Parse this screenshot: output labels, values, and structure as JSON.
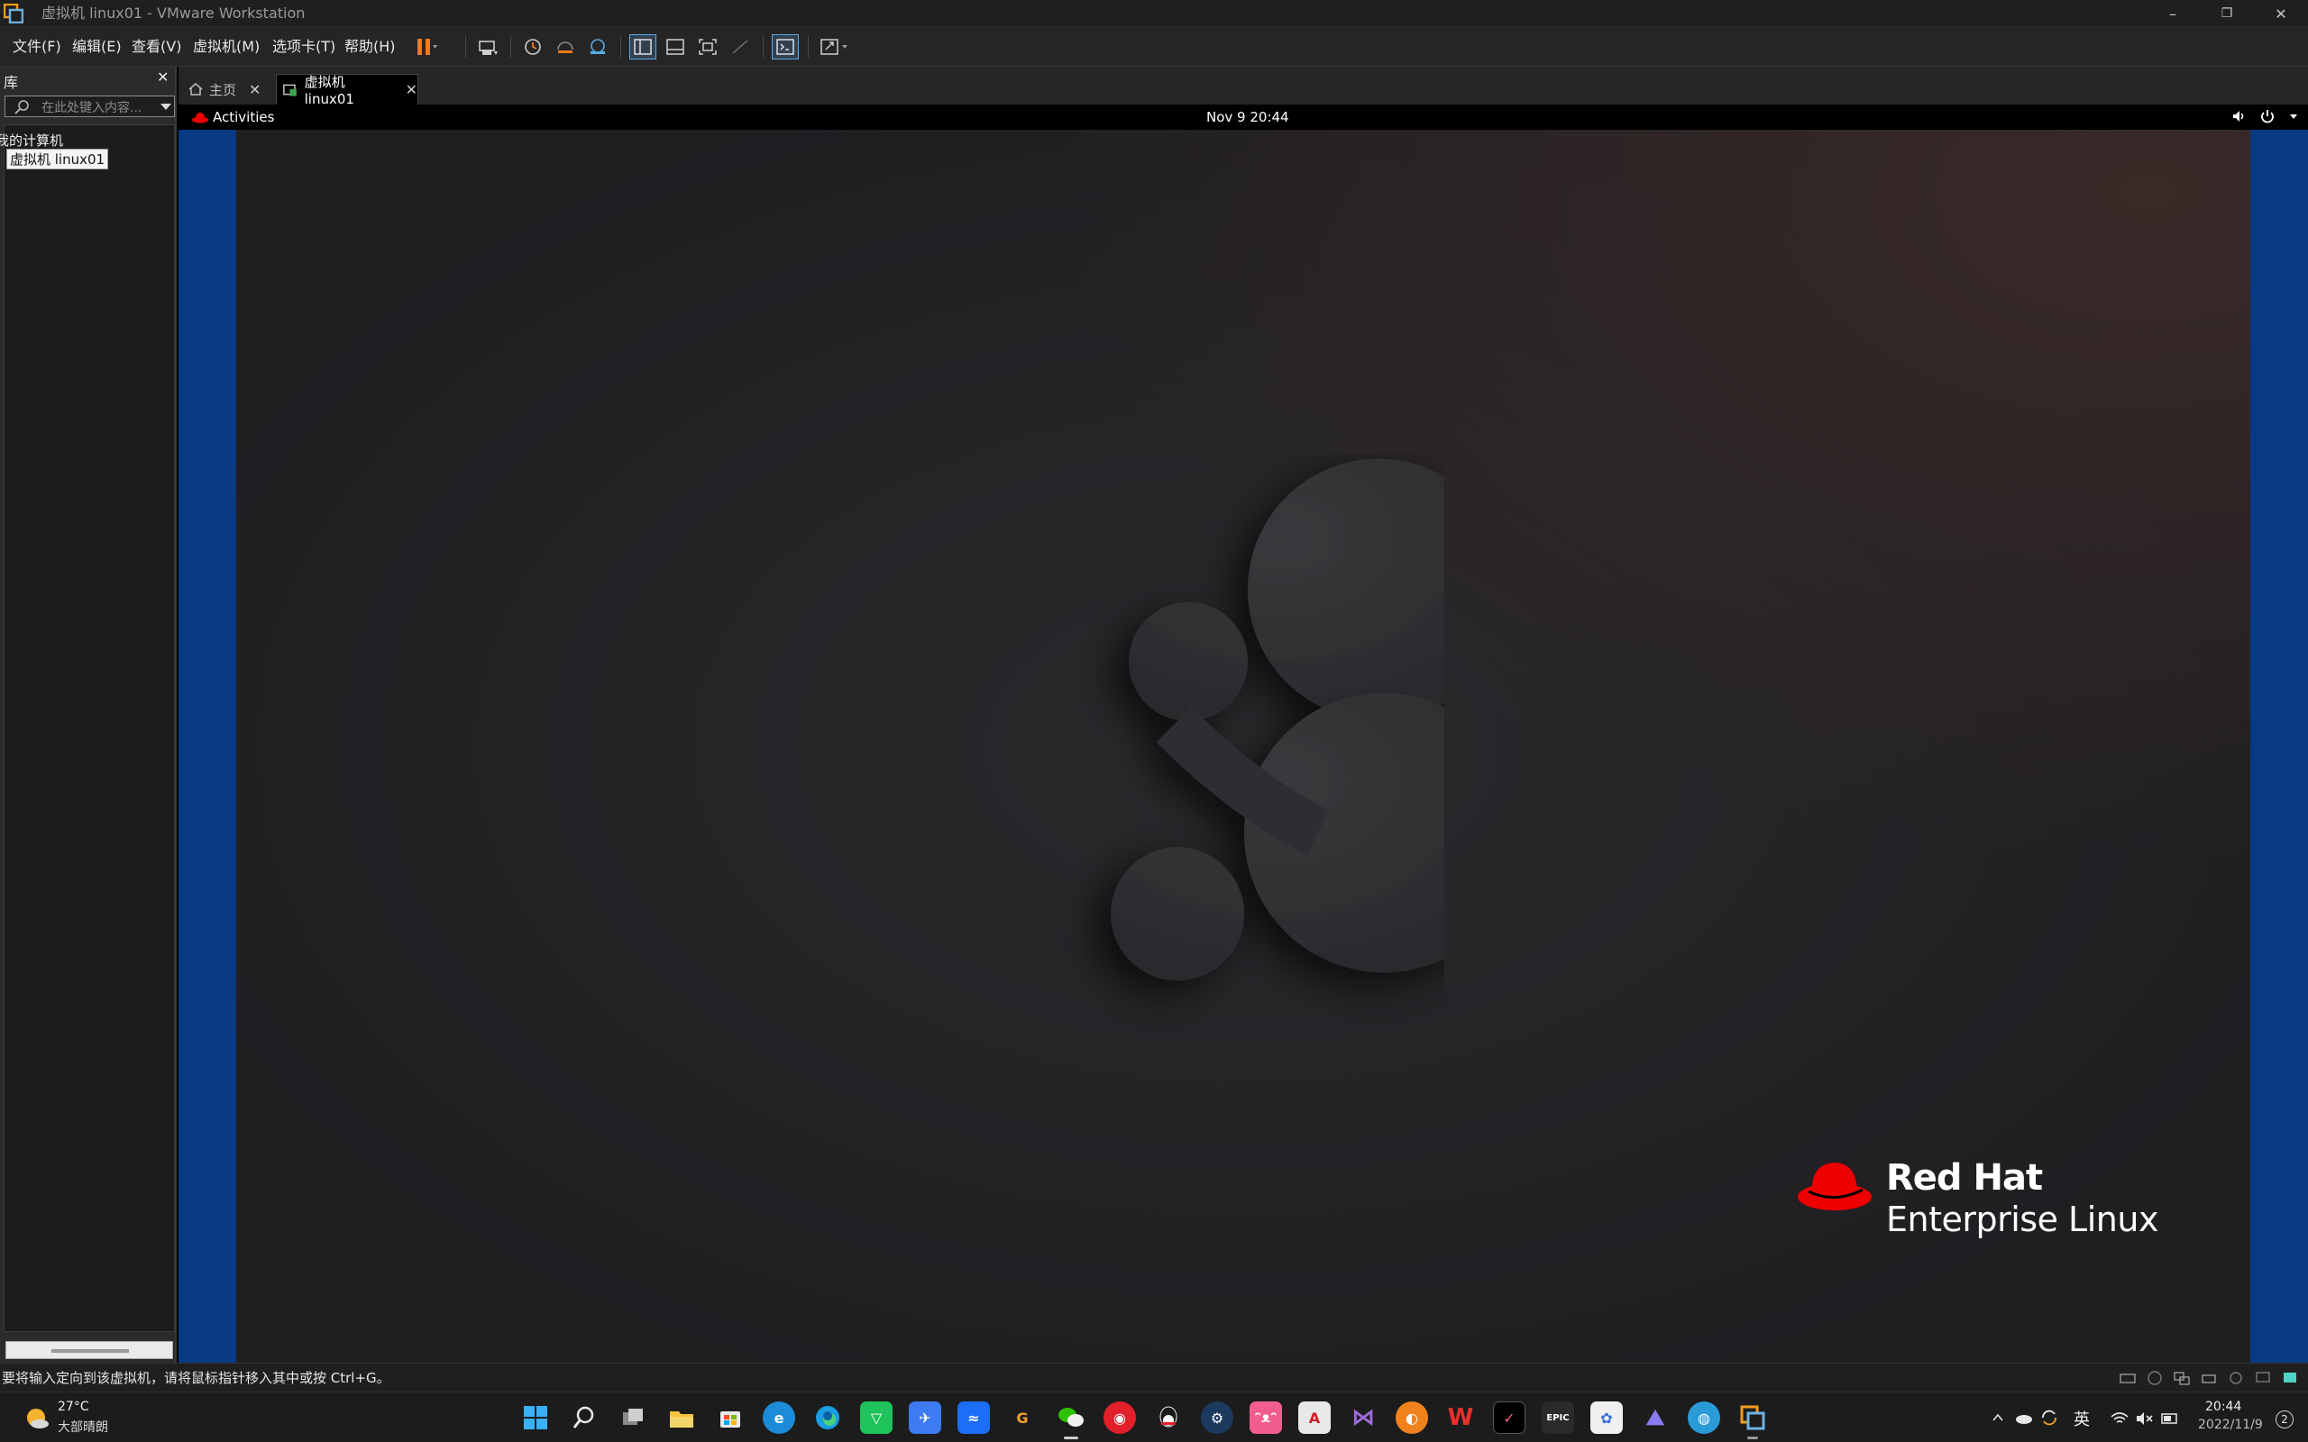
{
  "window": {
    "title": "虚拟机 linux01 - VMware Workstation",
    "controls": {
      "minimize": "–",
      "restore": "❐",
      "close": "✕"
    }
  },
  "menu": [
    "文件(F)",
    "编辑(E)",
    "查看(V)",
    "虚拟机(M)",
    "选项卡(T)",
    "帮助(H)"
  ],
  "library": {
    "title": "库",
    "close": "✕",
    "search_placeholder": "在此处键入内容...",
    "tree": [
      "我的计算机",
      "虚拟机 linux01"
    ]
  },
  "tabs": [
    {
      "label": "主页",
      "close": "✕"
    },
    {
      "label": "虚拟机 linux01",
      "close": "✕",
      "active": true
    }
  ],
  "guest": {
    "activities": "Activities",
    "clock": "Nov 9  20:44",
    "brand_line1": "Red Hat",
    "brand_line2": "Enterprise Linux",
    "colors": {
      "redhat_red": "#ee0000",
      "vm_border_blue": "#073a82"
    }
  },
  "status": {
    "text": "要将输入定向到该虚拟机，请将鼠标指针移入其中或按 Ctrl+G。"
  },
  "taskbar": {
    "weather_temp": "27°C",
    "weather_desc": "大部晴朗",
    "ime": "英",
    "time": "20:44",
    "date": "2022/11/9",
    "notifications": "2",
    "apps": [
      "start-icon",
      "search-icon",
      "task-view-icon",
      "file-explorer-icon",
      "store-icon",
      "ie-icon",
      "edge-icon",
      "wechat-work-icon",
      "feishu-icon",
      "lanhu-icon",
      "grammarly-icon",
      "wechat-icon",
      "netease-music-icon",
      "qq-icon",
      "steam-icon",
      "bilibili-icon",
      "autocad-icon",
      "visual-studio-icon",
      "app-orange-icon",
      "wps-icon",
      "jetbrains-icon",
      "epic-games-icon",
      "collab-icon",
      "image-viewer-icon",
      "browser-globe-icon",
      "vmware-icon"
    ]
  }
}
